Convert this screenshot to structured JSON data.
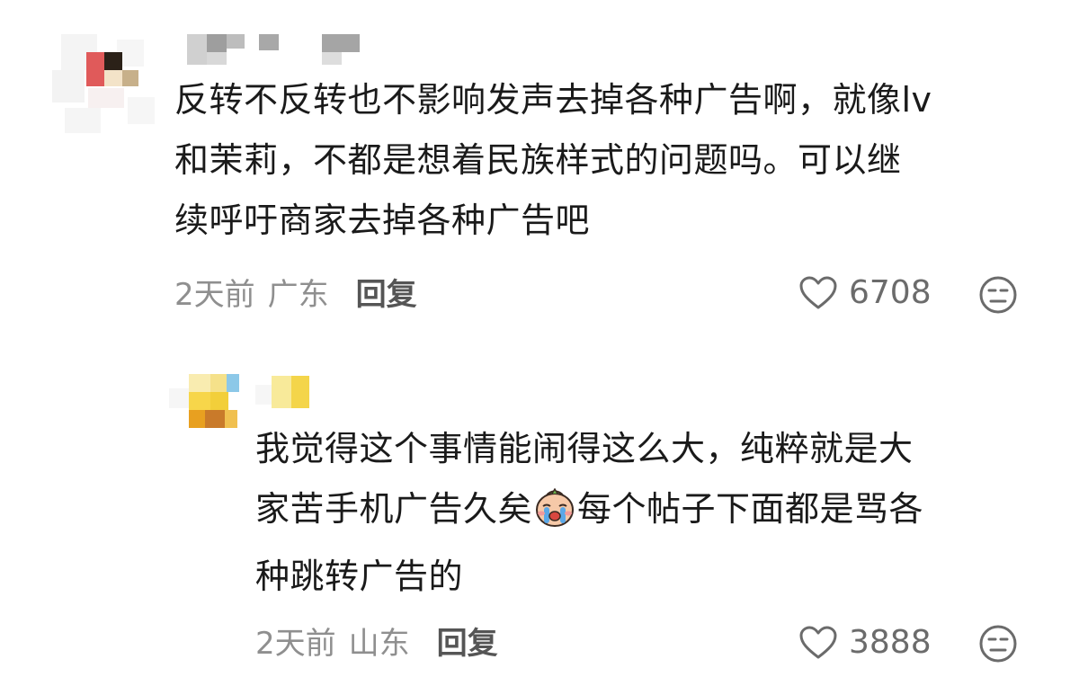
{
  "comments": [
    {
      "text_lines": [
        "反转不反转也不影响发声去掉各种广告啊，就像lv",
        "和茉莉，不都是想着民族样式的问题吗。可以继",
        "续呼吁商家去掉各种广告吧"
      ],
      "time": "2天前",
      "location": "广东",
      "reply_label": "回复",
      "likes": "6708",
      "avatar_colors": [
        "#e05a5a",
        "#2b2118",
        "#c7b08a",
        "#f2c9c9"
      ],
      "username_blurred": true
    },
    {
      "text_lines": [
        "我觉得这个事情能闹得这么大，纯粹就是大",
        "家苦手机广告久矣",
        "每个帖子下面都是骂各",
        "种跳转广告的"
      ],
      "emoji": "crying-face-emoji",
      "time": "2天前",
      "location": "山东",
      "reply_label": "回复",
      "likes": "3888",
      "avatar_colors": [
        "#f7d64a",
        "#8cc8e8",
        "#c97a2a",
        "#e8a020"
      ],
      "username_blurred": true
    }
  ],
  "icons": {
    "like": "heart-outline-icon",
    "dislike": "meh-face-icon"
  }
}
